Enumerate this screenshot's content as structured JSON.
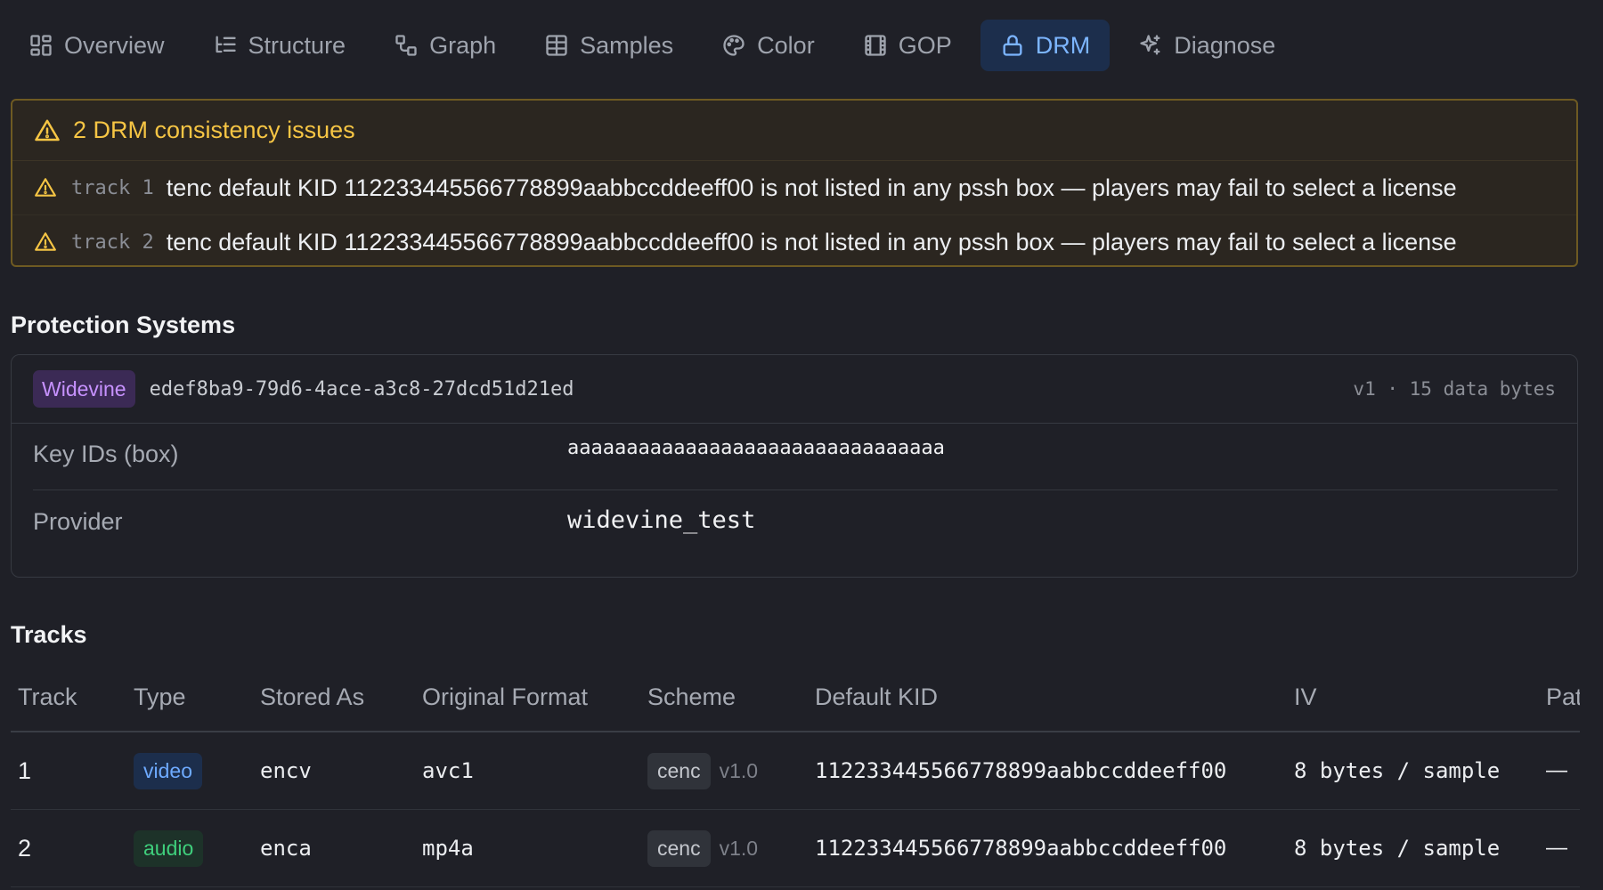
{
  "tabs": [
    {
      "label": "Overview",
      "icon": "grid-icon"
    },
    {
      "label": "Structure",
      "icon": "list-tree-icon"
    },
    {
      "label": "Graph",
      "icon": "graph-icon"
    },
    {
      "label": "Samples",
      "icon": "table-icon"
    },
    {
      "label": "Color",
      "icon": "palette-icon"
    },
    {
      "label": "GOP",
      "icon": "film-icon"
    },
    {
      "label": "DRM",
      "icon": "lock-icon",
      "active": true
    },
    {
      "label": "Diagnose",
      "icon": "sparkles-icon"
    }
  ],
  "issues": {
    "title": "2 DRM consistency issues",
    "items": [
      {
        "track": "track 1",
        "message": "tenc default KID 112233445566778899aabbccddeeff00 is not listed in any pssh box — players may fail to select a license"
      },
      {
        "track": "track 2",
        "message": "tenc default KID 112233445566778899aabbccddeeff00 is not listed in any pssh box — players may fail to select a license"
      }
    ]
  },
  "protection": {
    "title": "Protection Systems",
    "system": {
      "name": "Widevine",
      "uuid": "edef8ba9-79d6-4ace-a3c8-27dcd51d21ed",
      "meta": "v1 · 15 data bytes",
      "rows": [
        {
          "label": "Key IDs (box)",
          "value": "aaaaaaaaaaaaaaaaaaaaaaaaaaaaaaaa"
        },
        {
          "label": "Provider",
          "value": "widevine_test"
        }
      ]
    }
  },
  "tracks": {
    "title": "Tracks",
    "columns": [
      "Track",
      "Type",
      "Stored As",
      "Original Format",
      "Scheme",
      "Default KID",
      "IV",
      "Pat"
    ],
    "rows": [
      {
        "track": "1",
        "type": "video",
        "stored": "encv",
        "original": "avc1",
        "scheme": "cenc",
        "scheme_version": "v1.0",
        "kid": "112233445566778899aabbccddeeff00",
        "iv": "8 bytes / sample",
        "pattern": "—"
      },
      {
        "track": "2",
        "type": "audio",
        "stored": "enca",
        "original": "mp4a",
        "scheme": "cenc",
        "scheme_version": "v1.0",
        "kid": "112233445566778899aabbccddeeff00",
        "iv": "8 bytes / sample",
        "pattern": "—"
      }
    ]
  },
  "colors": {
    "background": "#1f2027",
    "accent": "#7cb5ff",
    "warning": "#f6c544",
    "widevine": "#c792ff",
    "audio": "#3fcf7c"
  }
}
